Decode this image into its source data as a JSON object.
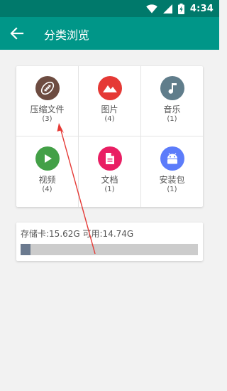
{
  "status_bar": {
    "time": "4:34"
  },
  "toolbar": {
    "title": "分类浏览"
  },
  "categories": [
    {
      "label": "压缩文件",
      "count": "(3)",
      "icon": "football-icon",
      "color": "#6d4c41"
    },
    {
      "label": "图片",
      "count": "(4)",
      "icon": "mountain-image-icon",
      "color": "#e53935"
    },
    {
      "label": "音乐",
      "count": "(1)",
      "icon": "music-note-icon",
      "color": "#607d8b"
    },
    {
      "label": "视频",
      "count": "(4)",
      "icon": "play-icon",
      "color": "#43a047"
    },
    {
      "label": "文档",
      "count": "(1)",
      "icon": "document-icon",
      "color": "#e91e63"
    },
    {
      "label": "安装包",
      "count": "(1)",
      "icon": "android-icon",
      "color": "#5c7cfa"
    }
  ],
  "storage": {
    "text": "存储卡:15.62G 可用:14.74G",
    "used_fraction": 0.056,
    "bar_fill_color": "#6b7a8f"
  },
  "colors": {
    "primary": "#009688",
    "primary_dark": "#00796b",
    "annotation_arrow": "#e53935"
  }
}
